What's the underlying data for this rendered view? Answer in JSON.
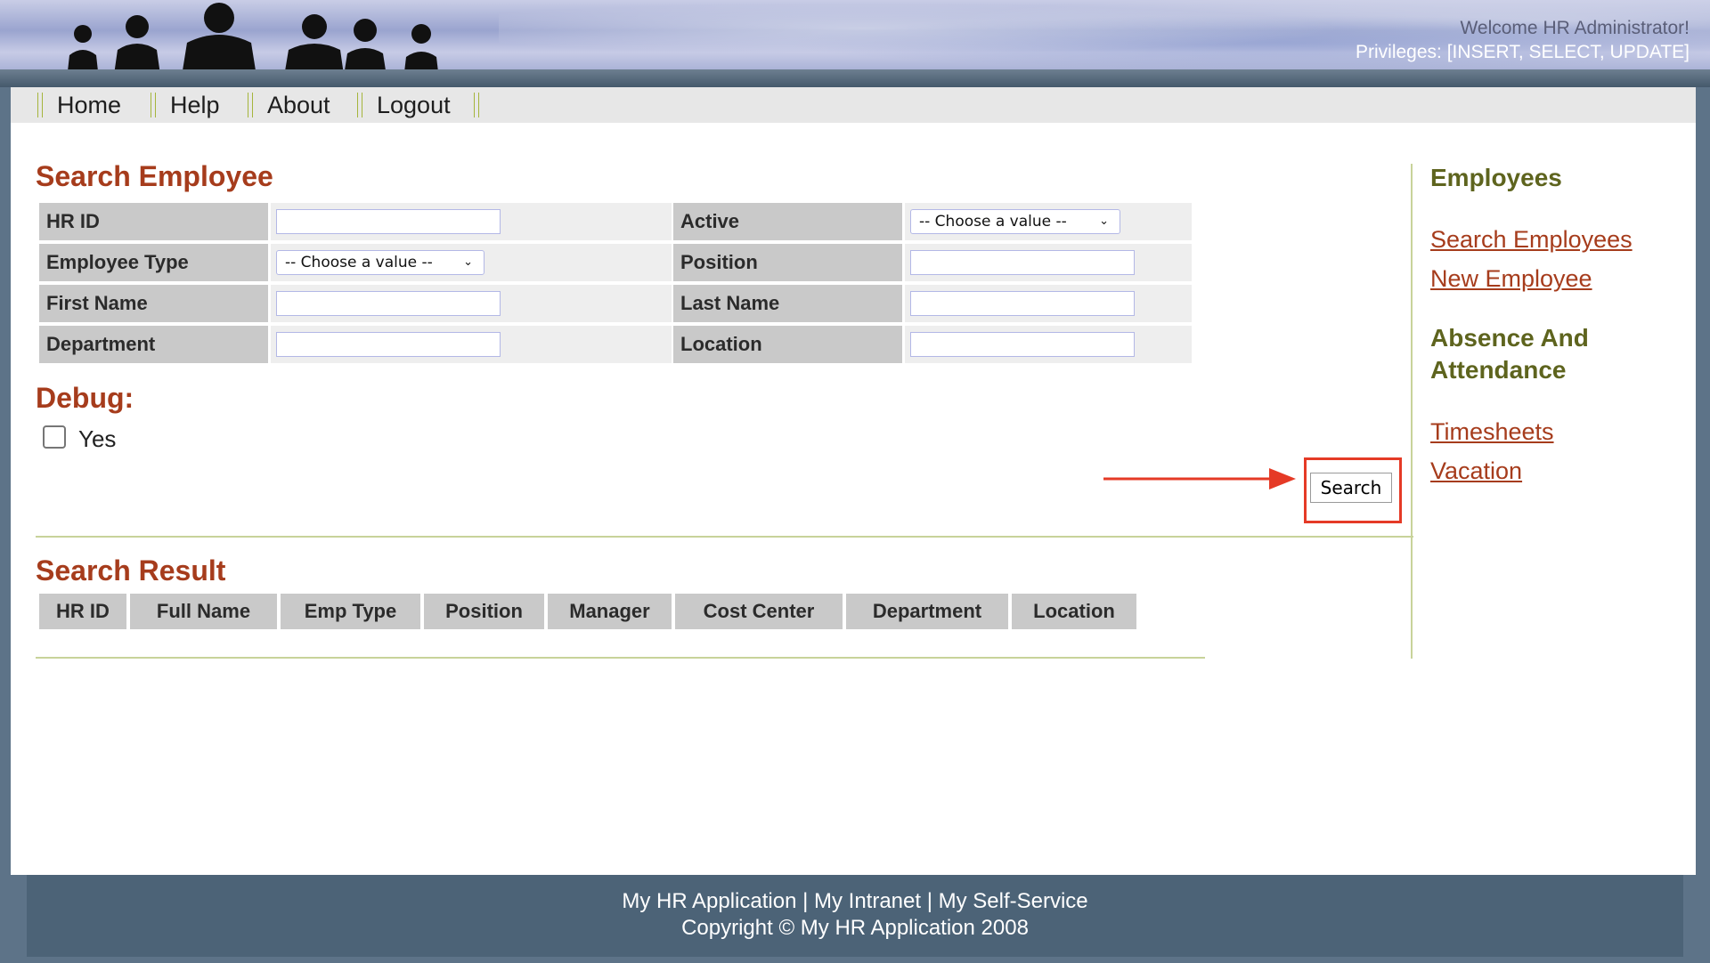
{
  "header": {
    "welcome": "Welcome HR Administrator!",
    "privileges": "Privileges: [INSERT, SELECT, UPDATE]"
  },
  "nav": {
    "items": [
      "Home",
      "Help",
      "About",
      "Logout"
    ]
  },
  "search_form": {
    "title": "Search Employee",
    "fields": {
      "hr_id": {
        "label": "HR ID",
        "value": ""
      },
      "active": {
        "label": "Active",
        "selected": "-- Choose a value --"
      },
      "employee_type": {
        "label": "Employee Type",
        "selected": "-- Choose a value --"
      },
      "position": {
        "label": "Position",
        "value": ""
      },
      "first_name": {
        "label": "First Name",
        "value": ""
      },
      "last_name": {
        "label": "Last Name",
        "value": ""
      },
      "department": {
        "label": "Department",
        "value": ""
      },
      "location": {
        "label": "Location",
        "value": ""
      }
    },
    "debug_title": "Debug:",
    "debug_checkbox_label": "Yes",
    "debug_checked": false,
    "search_button": "Search"
  },
  "results": {
    "title": "Search Result",
    "columns": [
      "HR ID",
      "Full Name",
      "Emp Type",
      "Position",
      "Manager",
      "Cost Center",
      "Department",
      "Location"
    ],
    "rows": []
  },
  "sidebar": {
    "employees_heading": "Employees",
    "employees_links": [
      "Search Employees",
      "New Employee"
    ],
    "absence_heading_line1": "Absence And",
    "absence_heading_line2": "Attendance",
    "absence_links": [
      "Timesheets",
      "Vacation"
    ]
  },
  "footer": {
    "links": "My HR Application | My Intranet | My Self-Service",
    "copyright": "Copyright © My HR Application 2008"
  },
  "colors": {
    "accent_red": "#a63c1c",
    "sidebar_olive": "#5e641e",
    "highlight": "#e53a26",
    "label_gray": "#c9c9c9",
    "footer_blue": "#4c6377"
  },
  "icons": {
    "select_chevron": "chevron-down-icon",
    "annotation_arrow": "arrow-right-icon"
  }
}
